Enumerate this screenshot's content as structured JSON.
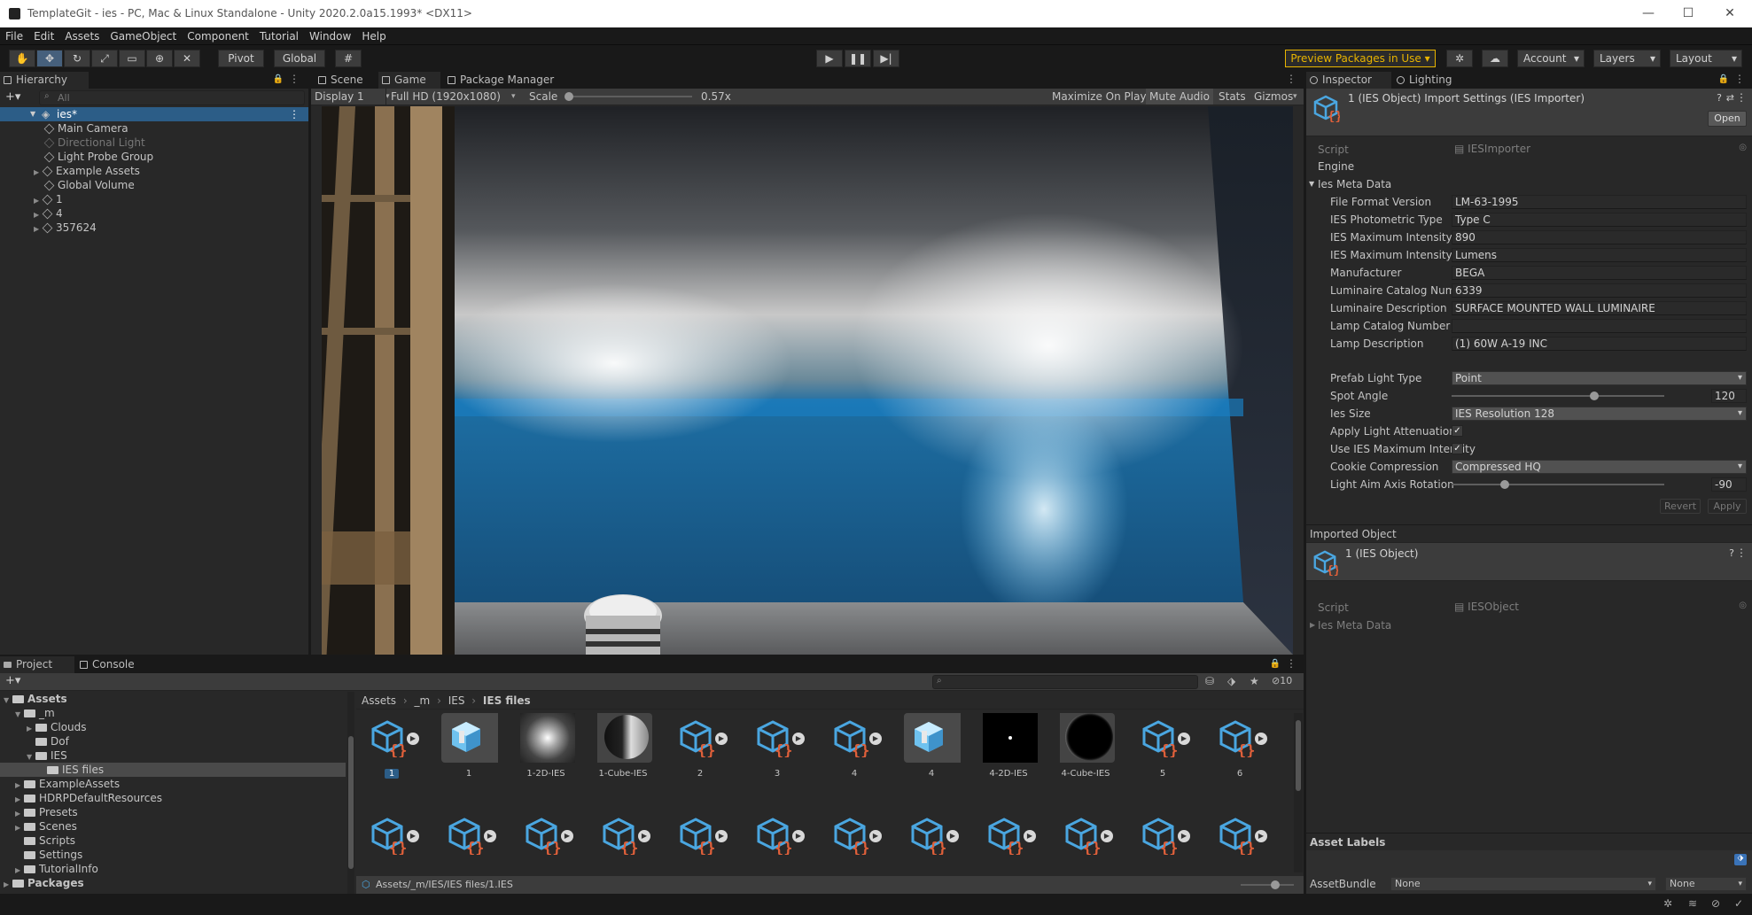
{
  "window": {
    "title": "TemplateGit - ies - PC, Mac & Linux Standalone - Unity 2020.2.0a15.1993* <DX11>"
  },
  "menu": [
    "File",
    "Edit",
    "Assets",
    "GameObject",
    "Component",
    "Tutorial",
    "Window",
    "Help"
  ],
  "toolbar": {
    "pivot_label": "Pivot",
    "global_label": "Global",
    "preview_packages": "Preview Packages in Use",
    "account": "Account",
    "layers": "Layers",
    "layout": "Layout"
  },
  "hierarchy": {
    "tab": "Hierarchy",
    "search_placeholder": "All",
    "scene": "ies*",
    "items": [
      {
        "label": "Main Camera",
        "disabled": false,
        "expandable": false
      },
      {
        "label": "Directional Light",
        "disabled": true,
        "expandable": false
      },
      {
        "label": "Light Probe Group",
        "disabled": false,
        "expandable": false
      },
      {
        "label": "Example Assets",
        "disabled": false,
        "expandable": true
      },
      {
        "label": "Global Volume",
        "disabled": false,
        "expandable": false
      },
      {
        "label": "1",
        "disabled": false,
        "expandable": true
      },
      {
        "label": "4",
        "disabled": false,
        "expandable": true
      },
      {
        "label": "357624",
        "disabled": false,
        "expandable": true
      }
    ]
  },
  "center": {
    "tabs": [
      "Scene",
      "Game",
      "Package Manager"
    ],
    "display": "Display 1",
    "resolution": "Full HD (1920x1080)",
    "scale_label": "Scale",
    "scale_value": "0.57x",
    "maximize": "Maximize On Play",
    "mute": "Mute Audio",
    "stats": "Stats",
    "gizmos": "Gizmos"
  },
  "inspector": {
    "tabs": [
      "Inspector",
      "Lighting"
    ],
    "header_title": "1 (IES Object) Import Settings (IES Importer)",
    "open_button": "Open",
    "script_label": "Script",
    "script_value": "IESImporter",
    "engine_label": "Engine",
    "meta_label": "Ies Meta Data",
    "fields": [
      {
        "label": "File Format Version",
        "value": "LM-63-1995"
      },
      {
        "label": "IES Photometric Type",
        "value": "Type C"
      },
      {
        "label": "IES Maximum Intensity",
        "value": "890"
      },
      {
        "label": "IES Maximum Intensity Unit",
        "value": "Lumens"
      },
      {
        "label": "Manufacturer",
        "value": "BEGA"
      },
      {
        "label": "Luminaire Catalog Number",
        "value": "6339"
      },
      {
        "label": "Luminaire Description",
        "value": "SURFACE MOUNTED WALL LUMINAIRE"
      },
      {
        "label": "Lamp Catalog Number",
        "value": ""
      },
      {
        "label": "Lamp Description",
        "value": "(1) 60W A-19 INC"
      }
    ],
    "prefab_light_type": {
      "label": "Prefab Light Type",
      "value": "Point"
    },
    "spot_angle": {
      "label": "Spot Angle",
      "value": "120",
      "fraction": 0.67
    },
    "ies_size": {
      "label": "Ies Size",
      "value": "IES Resolution 128"
    },
    "apply_attenuation": {
      "label": "Apply Light Attenuation",
      "checked": true
    },
    "use_max_intensity": {
      "label": "Use IES Maximum Intensity",
      "checked": true
    },
    "cookie_compression": {
      "label": "Cookie Compression",
      "value": "Compressed HQ"
    },
    "aim_rotation": {
      "label": "Light Aim Axis Rotation",
      "value": "-90",
      "fraction": 0.25
    },
    "revert": "Revert",
    "apply": "Apply",
    "imported_header": "Imported Object",
    "imported_title": "1 (IES Object)",
    "imported_script_value": "IESObject",
    "asset_labels": "Asset Labels",
    "assetbundle_label": "AssetBundle",
    "assetbundle_value": "None",
    "variant_value": "None"
  },
  "project": {
    "tabs": [
      "Project",
      "Console"
    ],
    "tree": [
      {
        "label": "Assets",
        "depth": 0,
        "open": true,
        "bold": true
      },
      {
        "label": "_m",
        "depth": 1,
        "open": true
      },
      {
        "label": "Clouds",
        "depth": 2,
        "open": false
      },
      {
        "label": "Dof",
        "depth": 2,
        "open": null
      },
      {
        "label": "IES",
        "depth": 2,
        "open": true
      },
      {
        "label": "IES files",
        "depth": 3,
        "open": null,
        "selected": true
      },
      {
        "label": "ExampleAssets",
        "depth": 1,
        "open": false
      },
      {
        "label": "HDRPDefaultResources",
        "depth": 1,
        "open": false
      },
      {
        "label": "Presets",
        "depth": 1,
        "open": false
      },
      {
        "label": "Scenes",
        "depth": 1,
        "open": false
      },
      {
        "label": "Scripts",
        "depth": 1,
        "open": null
      },
      {
        "label": "Settings",
        "depth": 1,
        "open": null
      },
      {
        "label": "TutorialInfo",
        "depth": 1,
        "open": false
      },
      {
        "label": "Packages",
        "depth": 0,
        "open": false,
        "bold": true
      }
    ],
    "breadcrumb": [
      "Assets",
      "_m",
      "IES",
      "IES files"
    ],
    "hidden_count": "10",
    "assets_row1": [
      {
        "label": "1",
        "kind": "ies",
        "selected": true
      },
      {
        "label": "1",
        "kind": "prefab"
      },
      {
        "label": "1-2D-IES",
        "kind": "glow"
      },
      {
        "label": "1-Cube-IES",
        "kind": "cube"
      },
      {
        "label": "2",
        "kind": "ies"
      },
      {
        "label": "3",
        "kind": "ies"
      },
      {
        "label": "4",
        "kind": "ies"
      },
      {
        "label": "4",
        "kind": "prefab"
      },
      {
        "label": "4-2D-IES",
        "kind": "dot"
      },
      {
        "label": "4-Cube-IES",
        "kind": "sphere"
      },
      {
        "label": "5",
        "kind": "ies"
      },
      {
        "label": "6",
        "kind": "ies"
      }
    ],
    "row2_count": 12,
    "status_path": "Assets/_m/IES/IES files/1.IES"
  },
  "colors": {
    "accent": "#46607c",
    "ies_blue": "#4aa6e0",
    "ies_orange": "#e0603a",
    "preview_yellow": "#e8b400"
  }
}
